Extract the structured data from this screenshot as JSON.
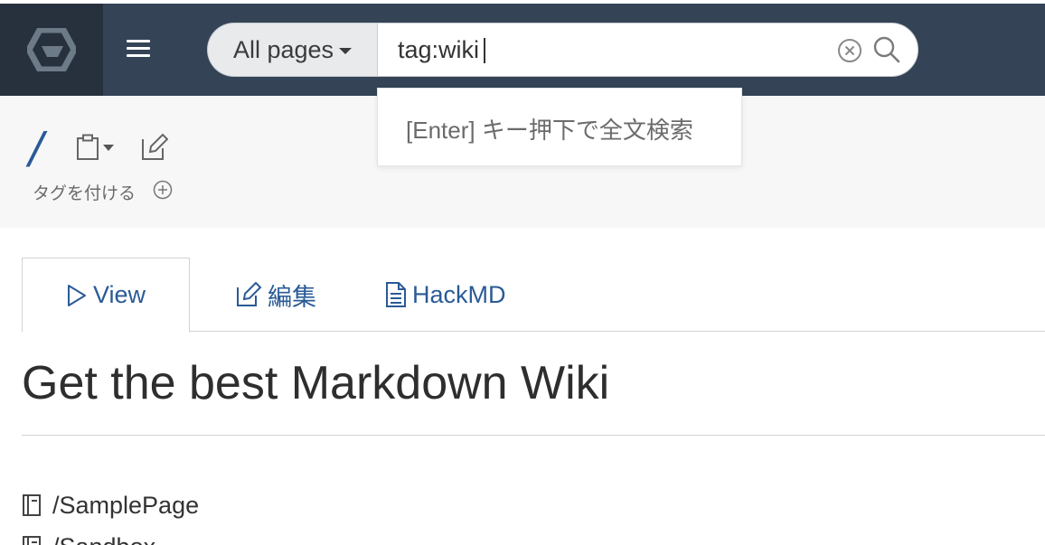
{
  "navbar": {
    "brand": "growi-logo",
    "menu_icon": "hamburger-icon",
    "search": {
      "scope_label": "All pages",
      "query": "tag:wiki",
      "clear_icon": "clear-circle-icon",
      "search_icon": "search-icon"
    }
  },
  "suggestion": {
    "text": "[Enter] キー押下で全文検索"
  },
  "header": {
    "path": "/",
    "tag_label": "タグを付ける"
  },
  "tabs": [
    {
      "label": "View",
      "icon": "play-icon"
    },
    {
      "label": "編集",
      "icon": "edit-icon"
    },
    {
      "label": "HackMD",
      "icon": "file-text-icon"
    }
  ],
  "content": {
    "title": "Get the best Markdown Wiki",
    "pages": [
      {
        "label": "/SamplePage"
      },
      {
        "label": "/Sandbox"
      }
    ]
  },
  "colors": {
    "navbar_bg": "#344456",
    "brand_bg": "#27313e",
    "link": "#2a5a96"
  }
}
